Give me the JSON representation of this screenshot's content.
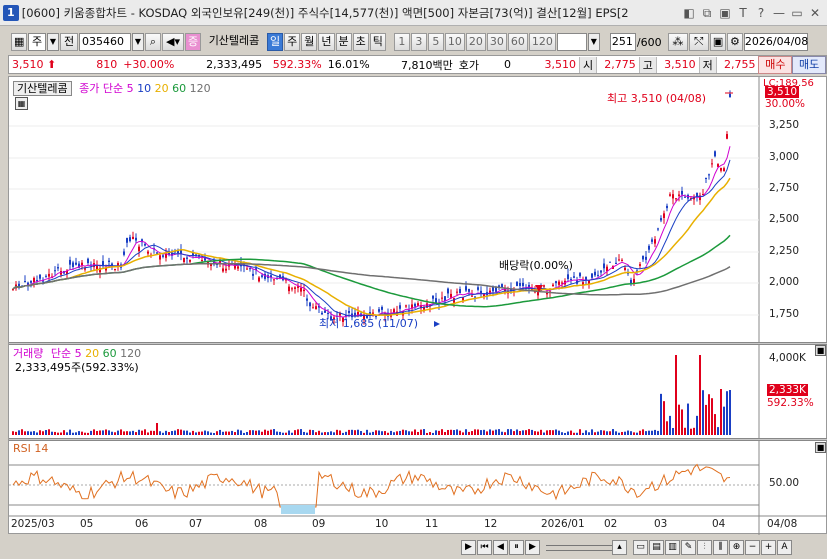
{
  "window": {
    "icon_label": "1",
    "title": "[0600] 키움종합차트 - KOSDAQ 외국인보유[249(천)] 주식수[14,577(천)] 액면[500] 자본금[73(억)] 결산[12월] EPS[2",
    "buttons": [
      "◧",
      "⧉",
      "▣",
      "T",
      "?",
      "—",
      "▭",
      "✕"
    ]
  },
  "toolbar": {
    "type_label": "주",
    "all_label": "전",
    "code": "035460",
    "stock_name": "기산텔레콤",
    "period_tabs": [
      "일",
      "주",
      "월",
      "년",
      "분",
      "초",
      "틱"
    ],
    "active_period": "일",
    "intervals": [
      "1",
      "3",
      "5",
      "10",
      "20",
      "30",
      "60",
      "120"
    ],
    "count": "251",
    "total": "/600",
    "date": "2026/04/08"
  },
  "quote": {
    "price": "3,510",
    "change": "810",
    "change_pct": "+30.00%",
    "volume": "2,333,495",
    "volume_ratio": "592.33%",
    "turnover": "16.01%",
    "amount": "7,810백만",
    "hoga_label": "호가",
    "hoga_value": "0",
    "ask": "3,510",
    "open_label": "시",
    "open": "2,775",
    "high_label": "고",
    "high": "3,510",
    "low_label": "저",
    "low": "2,755",
    "buy_label": "매수",
    "sell_label": "매도"
  },
  "price_pane": {
    "stock_name": "기산텔레콤",
    "ma_title": "종가 단순",
    "ma_periods": [
      "5",
      "10",
      "20",
      "60",
      "120"
    ],
    "ma_colors": [
      "#d000d0",
      "#1a3fc4",
      "#e8b000",
      "#1c9a3c",
      "#707070"
    ],
    "lc_label": "LC:189.56",
    "y_ticks": [
      "3,250",
      "3,000",
      "2,750",
      "2,500",
      "2,250",
      "2,000",
      "1,750"
    ],
    "current_price_tag": "3,510",
    "current_pct_tag": "30.00%",
    "high_annotation": "최고 3,510 (04/08)",
    "low_annotation": "최저 1,685 (11/07)",
    "dividend_annotation": "배당락(0.00%)"
  },
  "volume_pane": {
    "title": "거래량",
    "ma_title": "단순",
    "ma_periods": [
      "5",
      "20",
      "60",
      "120"
    ],
    "ma_colors": [
      "#d000d0",
      "#e8b000",
      "#1c9a3c",
      "#707070"
    ],
    "volume_text": "2,333,495주(592.33%)",
    "y_tick": "4,000K",
    "volume_tag": "2,333K",
    "volume_pct_tag": "592.33%"
  },
  "rsi_pane": {
    "title": "RSI 14",
    "y_tick": "50.00"
  },
  "x_axis": {
    "labels": [
      "2025/03",
      "05",
      "06",
      "07",
      "08",
      "09",
      "10",
      "11",
      "12",
      "2026/01",
      "02",
      "03",
      "04"
    ],
    "right_label": "04/08"
  },
  "colors": {
    "up": "#e0001b",
    "down": "#1a3fc4",
    "rsi": "#e07020"
  }
}
